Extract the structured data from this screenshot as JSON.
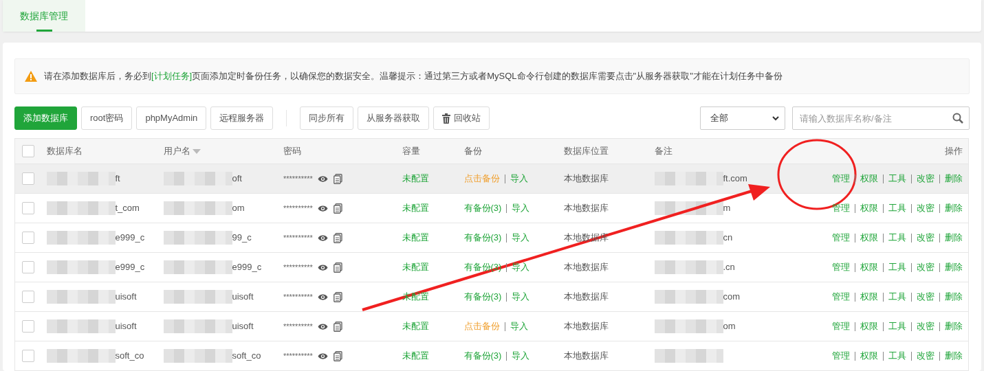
{
  "tabs": [
    {
      "label": "数据库管理",
      "selected": true
    }
  ],
  "notice": {
    "before": "请在添加数据库后，务必到",
    "link": "[计划任务]",
    "after": "页面添加定时备份任务，以确保您的数据安全。温馨提示：通过第三方或者MySQL命令行创建的数据库需要点击\"从服务器获取\"才能在计划任务中备份"
  },
  "toolbar": {
    "left_buttons": [
      {
        "label": "添加数据库",
        "kind": "primary"
      },
      {
        "label": "root密码",
        "kind": "default"
      },
      {
        "label": "phpMyAdmin",
        "kind": "default"
      },
      {
        "label": "远程服务器",
        "kind": "default"
      }
    ],
    "right_buttons": [
      {
        "label": "同步所有",
        "kind": "default"
      },
      {
        "label": "从服务器获取",
        "kind": "default"
      },
      {
        "label": "回收站",
        "kind": "trash"
      }
    ],
    "filter": {
      "value": "全部"
    },
    "search": {
      "placeholder": "请输入数据库名称/备注"
    }
  },
  "table": {
    "header_checked": false,
    "columns": [
      "数据库名",
      "用户名",
      "密码",
      "容量",
      "备份",
      "数据库位置",
      "备注",
      "操作"
    ],
    "rows": [
      {
        "checked": false,
        "highlighted": true,
        "name": "ft",
        "user": "oft",
        "password": "**********",
        "capacity": "未配置",
        "backup": {
          "kind": "none",
          "label": "点击备份"
        },
        "import": "导入",
        "location": "本地数据库",
        "remark": "ft.com",
        "actions": [
          "管理",
          "权限",
          "工具",
          "改密",
          "删除"
        ]
      },
      {
        "checked": false,
        "highlighted": false,
        "name": "t_com",
        "user": "om",
        "password": "**********",
        "capacity": "未配置",
        "backup": {
          "kind": "has",
          "label": "有备份(3)"
        },
        "import": "导入",
        "location": "本地数据库",
        "remark": "m",
        "actions": [
          "管理",
          "权限",
          "工具",
          "改密",
          "删除"
        ]
      },
      {
        "checked": false,
        "highlighted": false,
        "name": "e999_c",
        "user": "99_c",
        "password": "**********",
        "capacity": "未配置",
        "backup": {
          "kind": "has",
          "label": "有备份(3)"
        },
        "import": "导入",
        "location": "本地数据库",
        "remark": "cn",
        "actions": [
          "管理",
          "权限",
          "工具",
          "改密",
          "删除"
        ]
      },
      {
        "checked": false,
        "highlighted": false,
        "name": "e999_c",
        "user": "e999_c",
        "password": "**********",
        "capacity": "未配置",
        "backup": {
          "kind": "has",
          "label": "有备份(3)"
        },
        "import": "导入",
        "location": "本地数据库",
        "remark": ".cn",
        "actions": [
          "管理",
          "权限",
          "工具",
          "改密",
          "删除"
        ]
      },
      {
        "checked": false,
        "highlighted": false,
        "name": "uisoft",
        "user": "uisoft",
        "password": "**********",
        "capacity": "未配置",
        "backup": {
          "kind": "has",
          "label": "有备份(3)"
        },
        "import": "导入",
        "location": "本地数据库",
        "remark": "com",
        "actions": [
          "管理",
          "权限",
          "工具",
          "改密",
          "删除"
        ]
      },
      {
        "checked": false,
        "highlighted": false,
        "name": "uisoft",
        "user": "uisoft",
        "password": "**********",
        "capacity": "未配置",
        "backup": {
          "kind": "none",
          "label": "点击备份"
        },
        "import": "导入",
        "location": "本地数据库",
        "remark": "om",
        "actions": [
          "管理",
          "权限",
          "工具",
          "改密",
          "删除"
        ]
      },
      {
        "checked": false,
        "highlighted": false,
        "name": "soft_co",
        "user": "soft_co",
        "password": "**********",
        "capacity": "未配置",
        "backup": {
          "kind": "has",
          "label": "有备份(3)"
        },
        "import": "导入",
        "location": "本地数据库",
        "actions": [
          "管理",
          "权限",
          "工具",
          "改密",
          "删除"
        ]
      }
    ]
  },
  "annotations": [
    {
      "kind": "circle"
    },
    {
      "kind": "arrow"
    }
  ]
}
